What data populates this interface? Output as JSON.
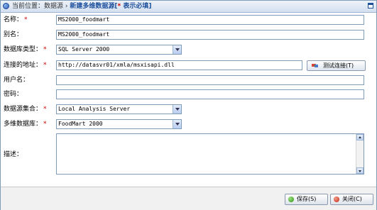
{
  "titlebar": {
    "prefix": "当前位置：",
    "path": "数据源",
    "separator": "›",
    "current": "新建多维数据源",
    "bracket_open": "[",
    "required_mark": "*",
    "required_note": " 表示必填",
    "bracket_close": "]"
  },
  "form": {
    "name": {
      "label": "名称：",
      "required": "*",
      "value": "MS2000_foodmart"
    },
    "alias": {
      "label": "别名：",
      "value": "MS2000_foodmart"
    },
    "db_type": {
      "label": "数据库类型：",
      "required": "*",
      "value": "SQL Server 2000"
    },
    "conn": {
      "label": "连接的地址：",
      "required": "*",
      "value": "http://datasvr01/xmla/msxisapi.dll"
    },
    "test_button": "测试连接(T)",
    "username": {
      "label": "用户名：",
      "value": ""
    },
    "password": {
      "label": "密码：",
      "value": ""
    },
    "ds_set": {
      "label": "数据源集合：",
      "required": "*",
      "value": "Local Analysis Server"
    },
    "cube_db": {
      "label": "多维数据库：",
      "required": "*",
      "value": "FoodMart 2000"
    },
    "description": {
      "label": "描述：",
      "value": ""
    }
  },
  "footer": {
    "save": "保存(S)",
    "close": "关闭(C)"
  },
  "colors": {
    "title_text": "#1d4f9c",
    "required": "#cc0000",
    "input_border": "#7f9db9"
  }
}
